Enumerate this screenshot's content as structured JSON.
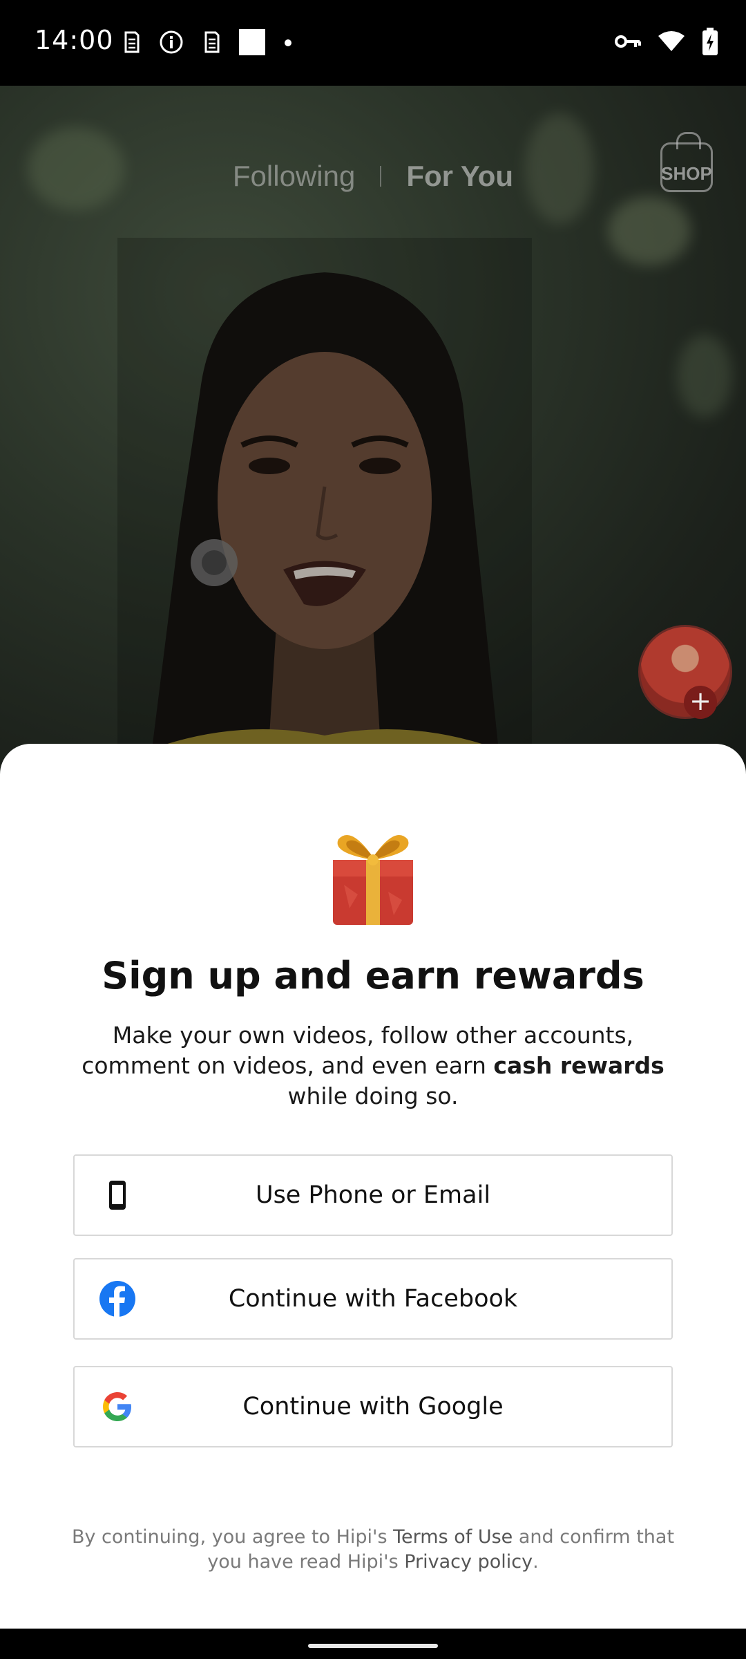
{
  "status_bar": {
    "time": "14:00",
    "left_icons": [
      "sim-icon",
      "info-icon",
      "sim-icon",
      "square-icon",
      "dot-icon"
    ],
    "right_icons": [
      "key-icon",
      "wifi-icon",
      "battery-charging-icon"
    ]
  },
  "video": {
    "tabs": {
      "following": "Following",
      "for_you": "For You"
    },
    "shop_label": "SHOP"
  },
  "sheet": {
    "title": "Sign up and earn rewards",
    "desc_prefix": "Make your own videos, follow other accounts, comment on videos, and even earn ",
    "desc_bold": "cash rewards",
    "desc_suffix": " while doing so.",
    "buttons": {
      "phone": "Use Phone or Email",
      "facebook": "Continue with Facebook",
      "google": "Continue with Google"
    },
    "legal": {
      "part1": "By continuing, you agree to Hipi's ",
      "terms": "Terms of Use",
      "part2": " and confirm that you have read Hipi's ",
      "privacy": "Privacy policy",
      "part3": "."
    }
  },
  "colors": {
    "facebook_blue": "#1877F2",
    "google_blue": "#4285F4",
    "google_red": "#EA4335",
    "google_yellow": "#FBBC05",
    "google_green": "#34A853"
  }
}
